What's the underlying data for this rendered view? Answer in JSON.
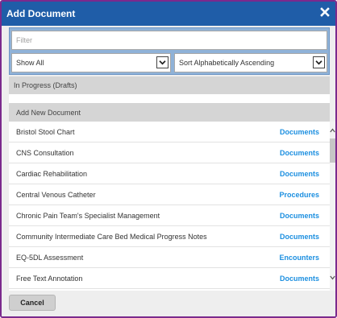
{
  "dialog": {
    "title": "Add Document",
    "close_icon": "close-icon"
  },
  "filter": {
    "placeholder": "Filter",
    "value": ""
  },
  "show_select": {
    "selected": "Show All",
    "icon": "chevron-down-icon"
  },
  "sort_select": {
    "selected": "Sort Alphabetically Ascending",
    "icon": "chevron-down-icon"
  },
  "sections": {
    "drafts": "In Progress (Drafts)",
    "add_new": "Add New Document"
  },
  "documents": [
    {
      "name": "Bristol Stool Chart",
      "category": "Documents"
    },
    {
      "name": "CNS Consultation",
      "category": "Documents"
    },
    {
      "name": "Cardiac Rehabilitation",
      "category": "Documents"
    },
    {
      "name": "Central Venous Catheter",
      "category": "Procedures"
    },
    {
      "name": "Chronic Pain Team's Specialist Management",
      "category": "Documents"
    },
    {
      "name": "Community Intermediate Care Bed Medical Progress Notes",
      "category": "Documents"
    },
    {
      "name": "EQ-5DL Assessment",
      "category": "Encounters"
    },
    {
      "name": "Free Text Annotation",
      "category": "Documents"
    }
  ],
  "footer": {
    "cancel_label": "Cancel"
  },
  "colors": {
    "titlebar": "#1f5da8",
    "frame_border": "#7b2a8d",
    "filter_panel": "#8fb2d8",
    "category_link": "#1c8fe0"
  }
}
